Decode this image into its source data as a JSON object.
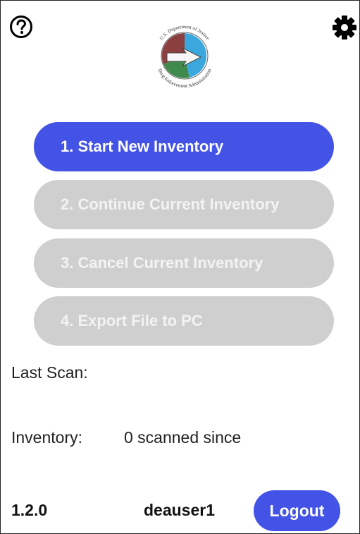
{
  "header": {
    "help_icon": "question-circle-icon",
    "settings_icon": "gear-icon",
    "seal_text": "U.S. Department of Justice • Drug Enforcement Administration"
  },
  "menu": {
    "start_new": "1. Start New Inventory",
    "continue_current": "2. Continue Current Inventory",
    "cancel_current": "3. Cancel Current Inventory",
    "export_file": "4. Export File to PC"
  },
  "status": {
    "last_scan_label": "Last Scan:",
    "inventory_label": "Inventory:",
    "inventory_value": "0 scanned since"
  },
  "footer": {
    "version": "1.2.0",
    "username": "deauser1",
    "logout_label": "Logout"
  },
  "colors": {
    "primary": "#4353e6",
    "disabled": "#cfcfcf"
  }
}
